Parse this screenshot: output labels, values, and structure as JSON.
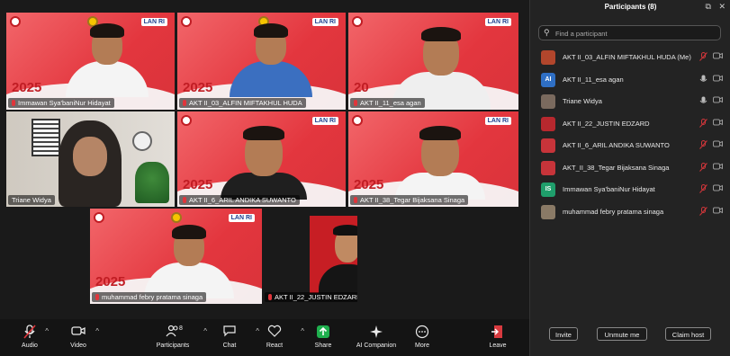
{
  "tiles": {
    "t1": {
      "name": "Immawan Sya'baniNur Hidayat",
      "year": "2025",
      "logo_text": "LAN RI"
    },
    "t2": {
      "name": "AKT II_03_ALFIN MIFTAKHUL HUDA",
      "year": "2025",
      "logo_text": "LAN RI"
    },
    "t3": {
      "name": "AKT II_11_esa agan",
      "year": "20",
      "logo_text": "LAN RI"
    },
    "t4": {
      "name": "Triane Widya"
    },
    "t5": {
      "name": "AKT II_6_ARIL ANDIKA SUWANTO",
      "year": "2025",
      "logo_text": "LAN RI"
    },
    "t6": {
      "name": "AKT II_38_Tegar Bijaksana Sinaga",
      "year": "2025",
      "logo_text": "LAN RI"
    },
    "t7": {
      "name": "muhammad febry pratama sinaga",
      "year": "2025",
      "logo_text": "LAN RI"
    },
    "t8": {
      "name": "AKT II_22_JUSTIN EDZARD"
    }
  },
  "toolbar": {
    "audio": "Audio",
    "video": "Video",
    "participants": "Participants",
    "participants_count": "8",
    "chat": "Chat",
    "react": "React",
    "share": "Share",
    "ai_companion": "AI Companion",
    "more": "More",
    "leave": "Leave"
  },
  "panel": {
    "title": "Participants (8)",
    "search_placeholder": "Find a participant",
    "participants": [
      {
        "name": "AKT II_03_ALFIN MIFTAKHUL HUDA (Me)",
        "avatar_text": "",
        "avatar_color": "#b2462c",
        "muted": true
      },
      {
        "name": "AKT II_11_esa agan",
        "avatar_text": "AI",
        "avatar_color": "#2f6fc4",
        "muted": false
      },
      {
        "name": "Triane Widya",
        "avatar_text": "",
        "avatar_color": "#7a6a5e",
        "muted": false
      },
      {
        "name": "AKT II_22_JUSTIN EDZARD",
        "avatar_text": "",
        "avatar_color": "#b7282e",
        "muted": true
      },
      {
        "name": "AKT II_6_ARIL ANDIKA SUWANTO",
        "avatar_text": "",
        "avatar_color": "#c7343a",
        "muted": true
      },
      {
        "name": "AKT_II_38_Tegar Bijaksana Sinaga",
        "avatar_text": "",
        "avatar_color": "#c7343a",
        "muted": true
      },
      {
        "name": "Immawan Sya'baniNur Hidayat",
        "avatar_text": "IS",
        "avatar_color": "#1f9e6b",
        "muted": true
      },
      {
        "name": "muhammad febry pratama sinaga",
        "avatar_text": "",
        "avatar_color": "#8a7a66",
        "muted": true
      }
    ],
    "invite": "Invite",
    "unmute_me": "Unmute me",
    "claim_host": "Claim host"
  }
}
